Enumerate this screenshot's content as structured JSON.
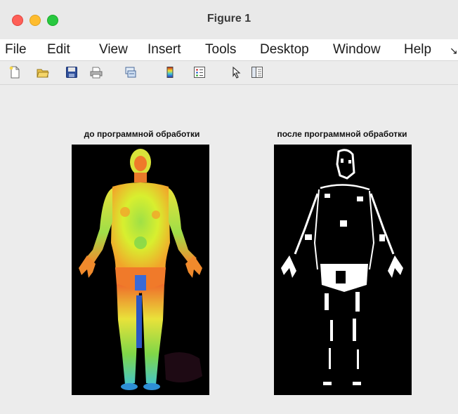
{
  "window": {
    "title": "Figure 1"
  },
  "menu": {
    "items": [
      {
        "label": "File"
      },
      {
        "label": "Edit"
      },
      {
        "label": "View"
      },
      {
        "label": "Insert"
      },
      {
        "label": "Tools"
      },
      {
        "label": "Desktop"
      },
      {
        "label": "Window"
      },
      {
        "label": "Help"
      }
    ],
    "overflow": "↘"
  },
  "toolbar": {
    "icons": [
      "new-figure-icon",
      "open-file-icon",
      "save-icon",
      "print-icon",
      "link-icon",
      "colorbar-icon",
      "legend-icon",
      "pointer-icon",
      "property-editor-icon"
    ]
  },
  "plots": [
    {
      "title": "до программной обработки"
    },
    {
      "title": "после программной обработки"
    }
  ],
  "colors": {
    "thermal_background": "#000000",
    "binary_background": "#000000"
  }
}
